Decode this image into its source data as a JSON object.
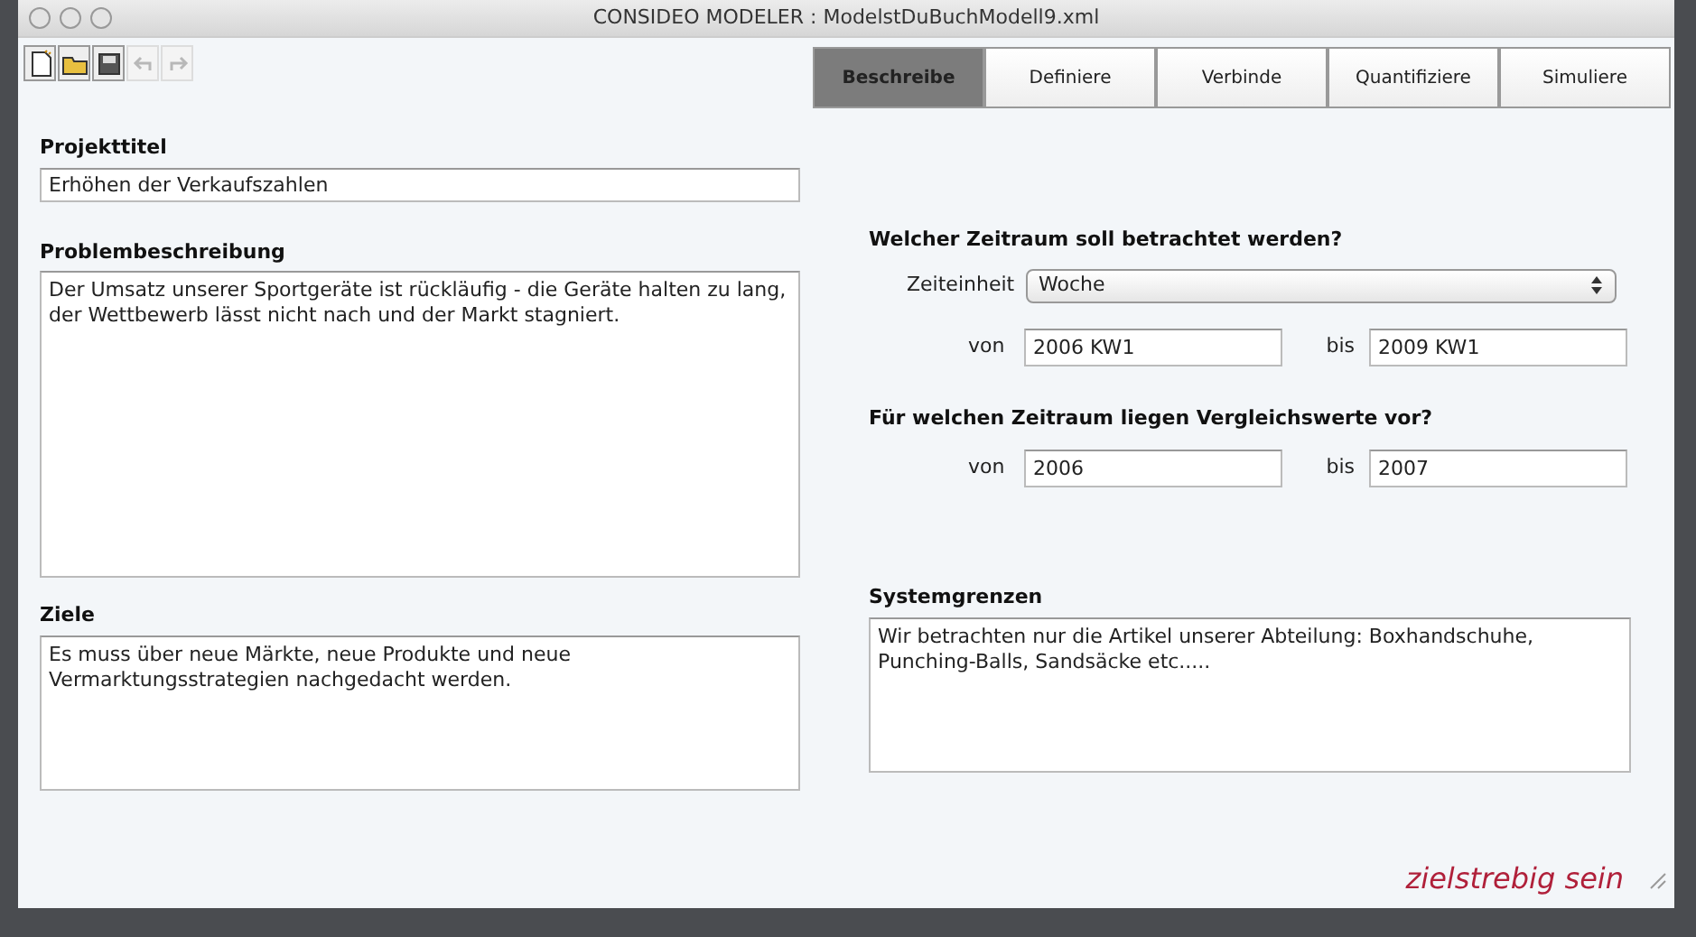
{
  "window": {
    "title": "CONSIDEO MODELER : ModelstDuBuchModell9.xml"
  },
  "toolbar": [
    {
      "kind": "new",
      "disabled": false
    },
    {
      "kind": "open",
      "disabled": false
    },
    {
      "kind": "save",
      "disabled": false
    },
    {
      "kind": "undo",
      "disabled": true
    },
    {
      "kind": "redo",
      "disabled": true
    }
  ],
  "tabs": [
    {
      "label": "Beschreibe",
      "selected": true
    },
    {
      "label": "Definiere",
      "selected": false
    },
    {
      "label": "Verbinde",
      "selected": false
    },
    {
      "label": "Quantifiziere",
      "selected": false
    },
    {
      "label": "Simuliere",
      "selected": false
    }
  ],
  "projekttitel": {
    "label": "Projekttitel",
    "value": "Erhöhen der Verkaufszahlen"
  },
  "problembeschreibung": {
    "label": "Problembeschreibung",
    "value": "Der Umsatz unserer Sportgeräte ist rückläufig - die Geräte halten zu lang,\nder Wettbewerb lässt nicht nach und der Markt stagniert."
  },
  "zeitraum": {
    "heading": "Welcher Zeitraum soll betrachtet werden?",
    "unit_label": "Zeiteinheit",
    "unit_value": "Woche",
    "from_label": "von",
    "from_value": "2006 KW1",
    "to_label": "bis",
    "to_value": "2009 KW1"
  },
  "vergleich": {
    "heading": "Für welchen Zeitraum liegen Vergleichswerte vor?",
    "from_label": "von",
    "from_value": "2006",
    "to_label": "bis",
    "to_value": "2007"
  },
  "ziele": {
    "label": "Ziele",
    "value": "Es muss über neue Märkte, neue Produkte und neue\nVermarktungsstrategien nachgedacht werden."
  },
  "systemgrenzen": {
    "label": "Systemgrenzen",
    "value": "Wir betrachten nur die Artikel unserer Abteilung: Boxhandschuhe,\nPunching-Balls, Sandsäcke etc....."
  },
  "caption": "zielstrebig sein"
}
